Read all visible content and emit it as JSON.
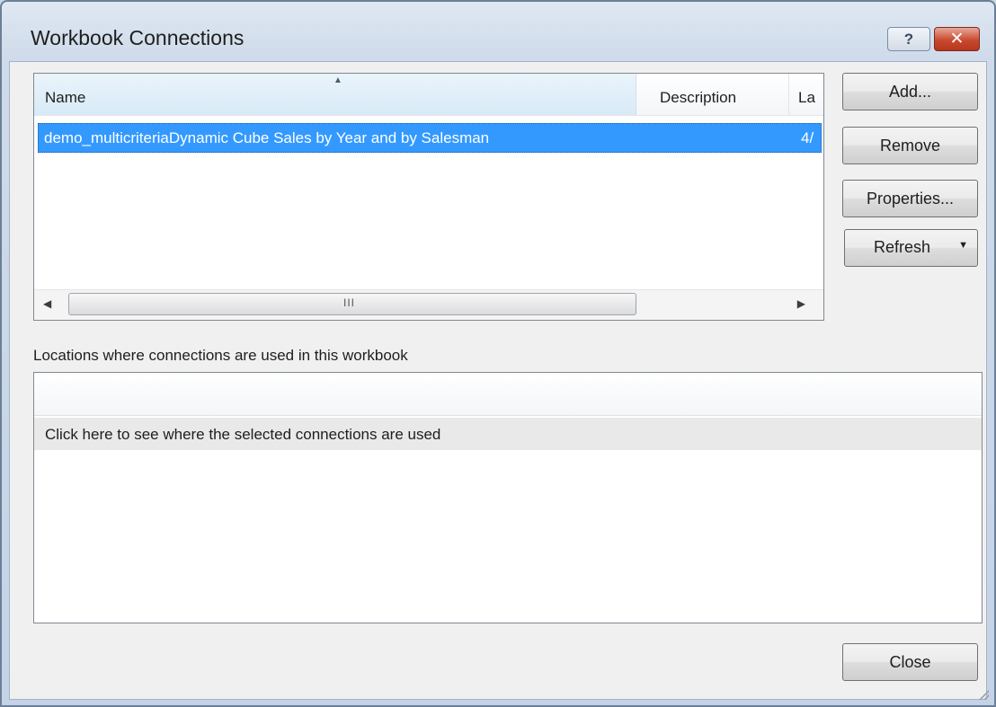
{
  "window": {
    "title": "Workbook Connections",
    "help_glyph": "?",
    "close_glyph": "✕"
  },
  "connections": {
    "columns": {
      "name": "Name",
      "description": "Description",
      "last_refreshed": "La",
      "sort_glyph": "▲"
    },
    "rows": [
      {
        "name": "demo_multicriteriaDynamic Cube Sales by Year and by Salesman",
        "description": "",
        "last_refreshed": "4/"
      }
    ],
    "scrollbar": {
      "left_glyph": "◀",
      "right_glyph": "▶",
      "grip_glyph": "III"
    }
  },
  "buttons": {
    "add": "Add...",
    "remove": "Remove",
    "properties": "Properties...",
    "refresh": "Refresh",
    "refresh_caret": "▼",
    "close": "Close"
  },
  "locations": {
    "label": "Locations where connections are used in this workbook",
    "hint_row": "Click here to see where the selected connections are used"
  },
  "colors": {
    "selection": "#3399ff",
    "title_bar": "#cfdbea",
    "close_button": "#c84a2e"
  }
}
